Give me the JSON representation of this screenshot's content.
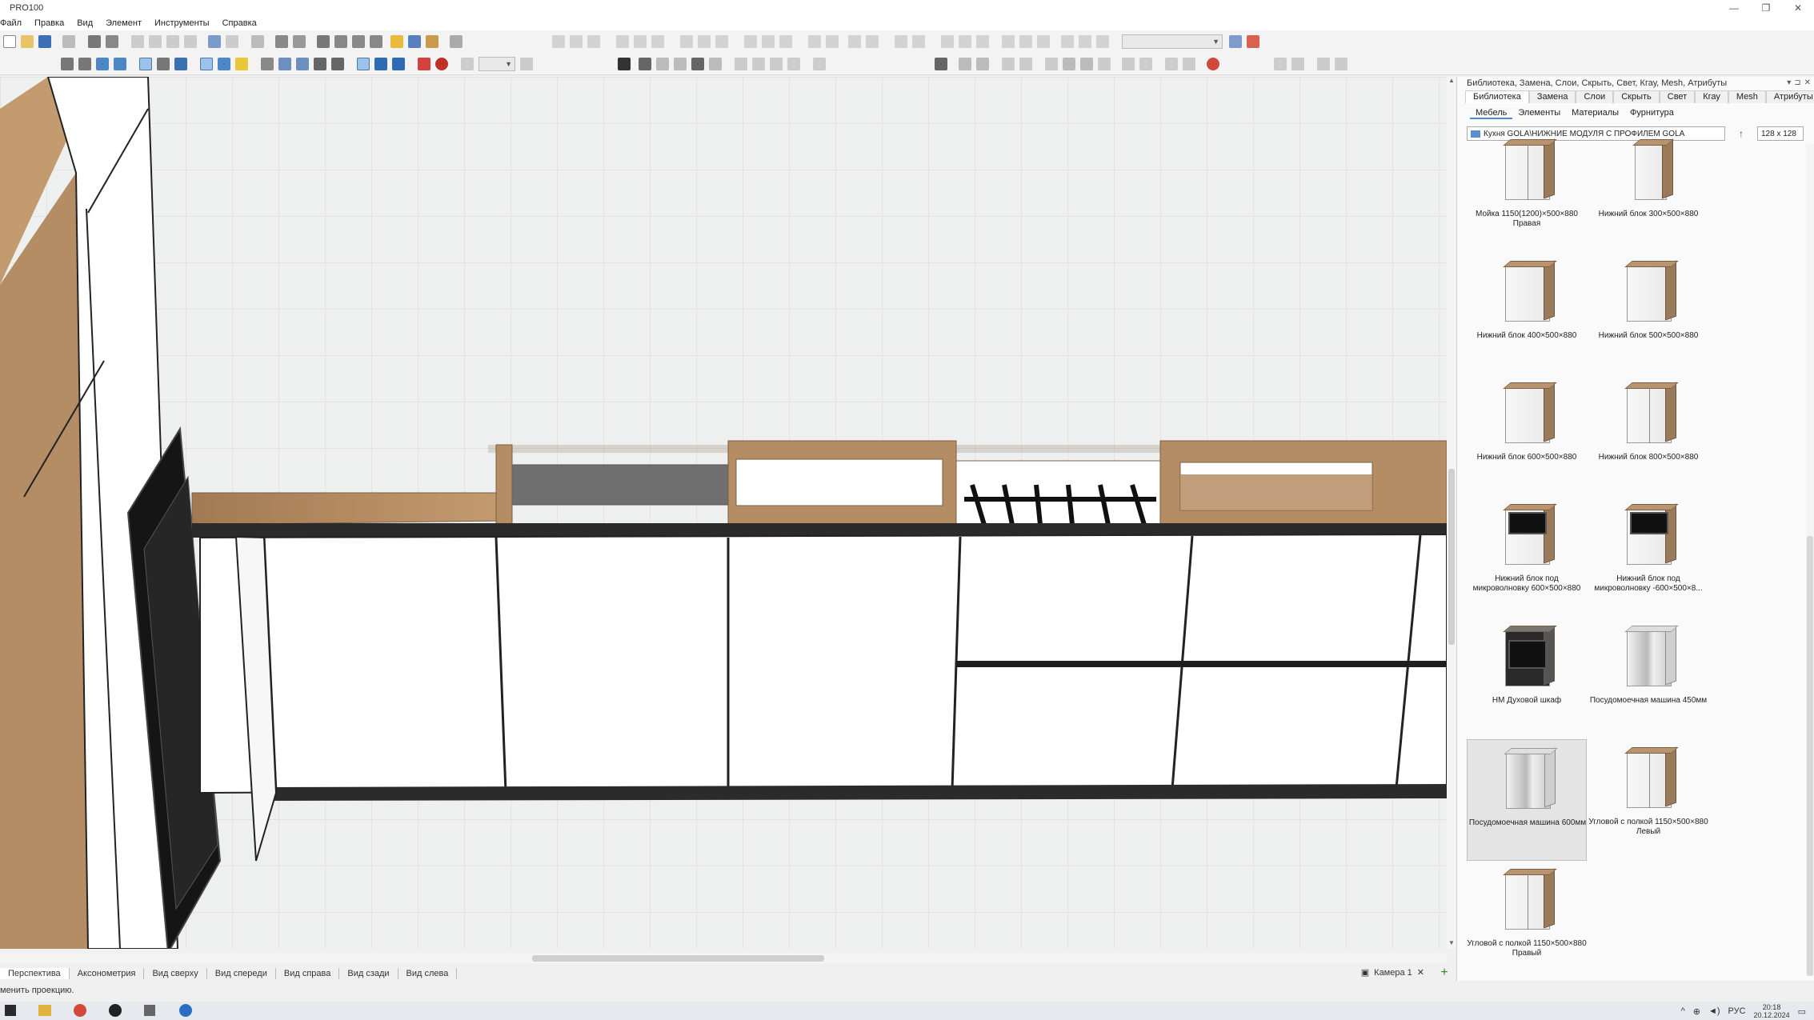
{
  "window": {
    "title": "PRO100",
    "controls": [
      "—",
      "❐",
      "✕"
    ]
  },
  "menu": [
    "Файл",
    "Правка",
    "Вид",
    "Элемент",
    "Инструменты",
    "Справка"
  ],
  "view_tabs": [
    "Перспектива",
    "Аксонометрия",
    "Вид сверху",
    "Вид спереди",
    "Вид справа",
    "Вид сзади",
    "Вид слева"
  ],
  "active_view_tab": "Перспектива",
  "camera_tab": {
    "label": "Камера 1",
    "close": "✕"
  },
  "add_tab": "+",
  "status": "менить проекцию.",
  "panel": {
    "title": "Библиотека, Замена, Слои, Скрыть, Свет, Кгау, Mesh, Атрибуты",
    "tabs": [
      "Библиотека",
      "Замена",
      "Слои",
      "Скрыть",
      "Свет",
      "Кгау",
      "Mesh",
      "Атрибуты"
    ],
    "active_tab": "Библиотека",
    "subtabs": [
      "Мебель",
      "Элементы",
      "Материалы",
      "Фурнитура"
    ],
    "active_subtab": "Мебель",
    "path": "Кухня GOLA\\НИЖНИЕ МОДУЛЯ С ПРОФИЛЕМ GOLA",
    "thumb_size": "128 x 128",
    "items": [
      {
        "label": "Мойка 1150(1200)×500×880 Правая",
        "kind": "corner"
      },
      {
        "label": "Нижний блок 300×500×880",
        "kind": "narrow"
      },
      {
        "label": "Нижний блок 400×500×880",
        "kind": "single"
      },
      {
        "label": "Нижний блок 500×500×880",
        "kind": "single"
      },
      {
        "label": "Нижний блок 600×500×880",
        "kind": "single"
      },
      {
        "label": "Нижний блок 800×500×880",
        "kind": "double"
      },
      {
        "label": "Нижний блок под микроволновку 600×500×880",
        "kind": "micro"
      },
      {
        "label": "Нижний блок под микроволновку -600×500×8...",
        "kind": "micro"
      },
      {
        "label": "НМ Духовой шкаф",
        "kind": "oven"
      },
      {
        "label": "Посудомоечная машина 450мм",
        "kind": "steel"
      },
      {
        "label": "Посудомоечная машина 600мм",
        "kind": "steel",
        "selected": true
      },
      {
        "label": "Угловой с полкой 1150×500×880 Левый",
        "kind": "corner"
      },
      {
        "label": "Угловой с полкой 1150×500×880 Правый",
        "kind": "corner"
      }
    ]
  },
  "taskbar": {
    "lang": "РУС",
    "time": "20:18",
    "date": "20.12.2024"
  },
  "colors": {
    "wood": "#b58d64",
    "counter_dark": "#2b2b2b",
    "grid_line": "#e2d3c4",
    "panel_select": "#e4e4e4"
  }
}
